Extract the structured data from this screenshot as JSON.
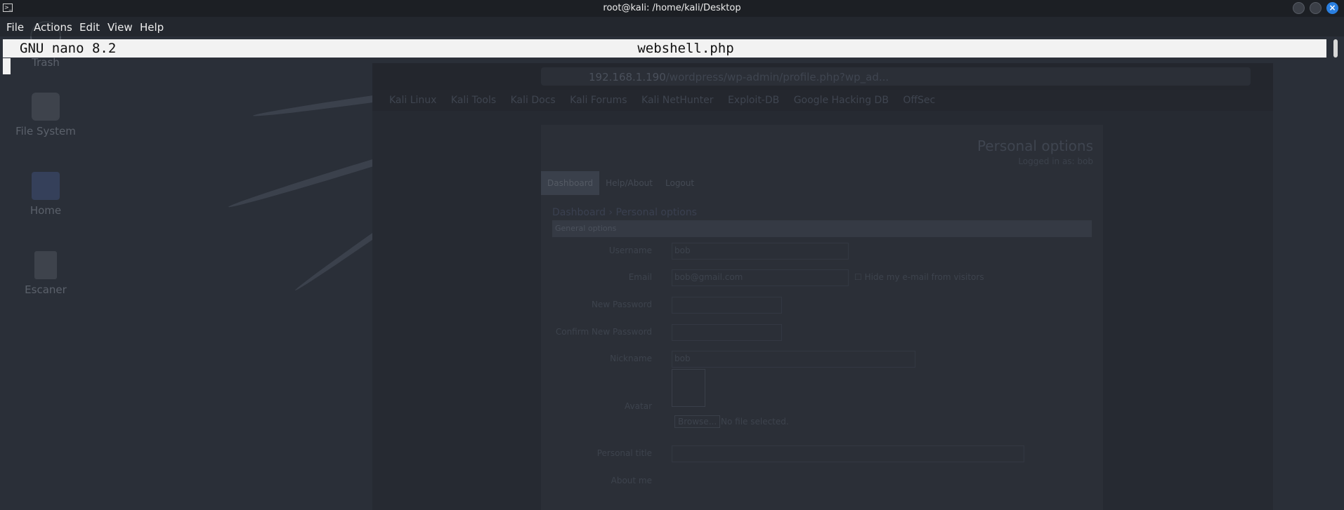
{
  "window": {
    "title": "root@kali: /home/kali/Desktop"
  },
  "menu": {
    "items": [
      "File",
      "Actions",
      "Edit",
      "View",
      "Help"
    ]
  },
  "nano": {
    "version_label": "GNU nano 8.2",
    "filename": "webshell.php"
  },
  "desktop": {
    "icons": [
      "Trash",
      "File System",
      "Home",
      "Escaner"
    ]
  },
  "browser": {
    "url_host": "192.168.1.190",
    "url_path": "/wordpress/wp-admin/profile.php?wp_ad...",
    "bookmarks": [
      "Kali Linux",
      "Kali Tools",
      "Kali Docs",
      "Kali Forums",
      "Kali NetHunter",
      "Exploit-DB",
      "Google Hacking DB",
      "OffSec"
    ],
    "page": {
      "title": "Personal options",
      "subtitle": "Logged in as: bob",
      "nav": [
        "Dashboard",
        "Help/About",
        "Logout"
      ],
      "breadcrumb": "Dashboard › Personal options",
      "section": "General options",
      "fields": [
        {
          "label": "Username",
          "value": "bob"
        },
        {
          "label": "Email",
          "value": "bob@gmail.com"
        },
        {
          "label": "New Password",
          "value": ""
        },
        {
          "label": "Confirm New Password",
          "value": ""
        },
        {
          "label": "Nickname",
          "value": "bob"
        },
        {
          "label": "Avatar",
          "value": ""
        },
        {
          "label": "Personal title",
          "value": ""
        },
        {
          "label": "About me",
          "value": ""
        }
      ],
      "hide_email_label": "Hide my e-mail from visitors",
      "browse_label": "Browse...",
      "no_file": "No file selected."
    }
  }
}
